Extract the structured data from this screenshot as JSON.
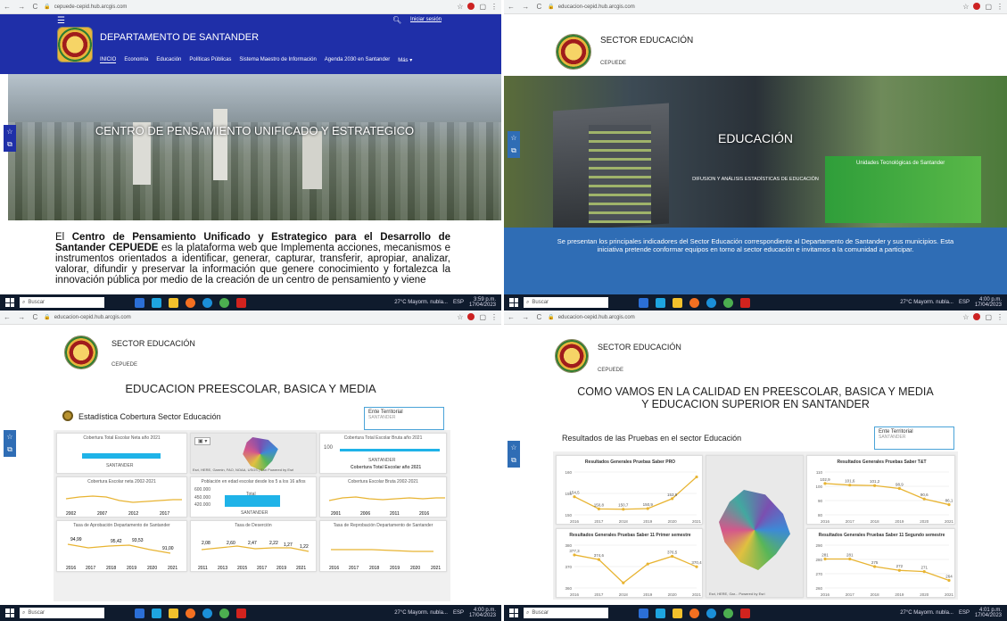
{
  "q1": {
    "url": "cepuede-cepid.hub.arcgis.com",
    "signin": "Iniciar sesión",
    "site_title": "DEPARTAMENTO DE SANTANDER",
    "nav": [
      "INICIO",
      "Economía",
      "Educación",
      "Políticas Públicas",
      "Sistema Maestro de Información",
      "Agenda 2030 en Santander",
      "Más ▾"
    ],
    "hero_title": "CENTRO DE PENSAMIENTO UNIFICADO Y ESTRATEGICO",
    "body_pre": "El ",
    "body_bold": "Centro de Pensamiento Unificado y Estrategico para el Desarrollo de Santander CEPUEDE",
    "body_rest": " es la plataforma web que Implementa acciones, mecanismos e instrumentos orientados a identificar, generar, capturar, transferir, apropiar, analizar, valorar, difundir y preservar la información que genere conocimiento y fortalezca la innovación pública por medio de la creación de un centro de pensamiento y viene",
    "taskbar": {
      "search": "Buscar",
      "weather": "27°C Mayorm. nubla...",
      "lang": "ESP",
      "time": "3:59 p.m.",
      "date": "17/04/2023"
    }
  },
  "q2": {
    "url": "educacion-cepid.hub.arcgis.com",
    "site_title": "SECTOR EDUCACIÓN",
    "subtitle": "CEPUEDE",
    "hero_title": "EDUCACIÓN",
    "hero_sub": "DIFUSION Y ANÁLISIS ESTADÍSTICAS DE EDUCACIÓN",
    "building_sign": "Unidades Tecnológicas de Santander",
    "banner": "Se presentan los principales indicadores del Sector Educación correspondiente al Departamento de Santander y sus municipios. Esta iniciativa pretende conformar equipos en torno al sector educación e invitamos a la comunidad a participar.",
    "taskbar": {
      "search": "Buscar",
      "weather": "27°C Mayorm. nubla...",
      "lang": "ESP",
      "time": "4:00 p.m.",
      "date": "17/04/2023"
    }
  },
  "q3": {
    "url": "educacion-cepid.hub.arcgis.com",
    "site_title": "SECTOR EDUCACIÓN",
    "subtitle": "CEPUEDE",
    "heading": "EDUCACION PREESCOLAR, BASICA Y MEDIA",
    "panel_title": "Estadística Cobertura Sector Educación",
    "ente_label": "Ente Territorial",
    "ente_value": "SANTANDER",
    "cards": {
      "c1": {
        "title": "Cobertura Total Escolar Neta año 2021",
        "ticks": [
          "80",
          "60",
          "40",
          "20",
          "0"
        ],
        "xlab": "SANTANDER"
      },
      "c2": {
        "title": "Cobertura Escolar neta 2002-2021",
        "xticks": [
          "2002",
          "2007",
          "2012",
          "2017"
        ]
      },
      "c3": {
        "title": "Tasa de Aprobación Departamento de Santander",
        "values": [
          "94,99",
          "95,42",
          "93,53",
          "91,00"
        ],
        "xticks": [
          "2016",
          "2017",
          "2018",
          "2019",
          "2020",
          "2021"
        ]
      },
      "c4": {
        "title": "Población en edad escolar desde los 5 a los 16 años",
        "ticks": [
          "600.000",
          "450.000",
          "420.000"
        ],
        "bar_label": "SANTANDER",
        "bar_value": "Total"
      },
      "c5": {
        "title": "Tasa de Deserción",
        "values": [
          "2,08",
          "2,60",
          "2,47",
          "2,22",
          "1,27",
          "1,22"
        ],
        "xticks": [
          "2011",
          "2013",
          "2015",
          "2017",
          "2019",
          "2021"
        ]
      },
      "c6": {
        "title": "Cobertura Total Escolar Bruta año 2021",
        "value": "100",
        "xlab": "SANTANDER",
        "sub": "Cobertura Total Escolar año 2021"
      },
      "c7": {
        "title": "Cobertura Escolar Bruta 2002-2021",
        "xticks": [
          "2001",
          "2006",
          "2011",
          "2016"
        ]
      },
      "c8": {
        "title": "Tasa de Reprobación Departamento de Santander",
        "xticks": [
          "2016",
          "2017",
          "2018",
          "2019",
          "2020",
          "2021"
        ]
      }
    },
    "map_credit": "Esri, HERE, Garmin, FAO, NOAA, USGS | Esri    Powered by Esri",
    "taskbar": {
      "search": "Buscar",
      "weather": "27°C Mayorm. nubla...",
      "lang": "ESP",
      "time": "4:00 p.m.",
      "date": "17/04/2023"
    }
  },
  "q4": {
    "url": "educacion-cepid.hub.arcgis.com",
    "site_title": "SECTOR EDUCACIÓN",
    "subtitle": "CEPUEDE",
    "heading1": "COMO VAMOS EN LA CALIDAD EN PREESCOLAR, BASICA Y MEDIA",
    "heading2": "Y EDUCACION SUPERIOR EN SANTANDER",
    "panel_title": "Resultados de las Pruebas en el sector Educación",
    "ente_label": "Ente Territorial",
    "ente_value": "SANTANDER",
    "map_credit": "Esri, HERE, Gar...    Powered by Esri",
    "taskbar": {
      "search": "Buscar",
      "weather": "27°C Mayorm. nubla...",
      "lang": "ESP",
      "time": "4:01 p.m.",
      "date": "17/04/2023"
    }
  },
  "chart_data": [
    {
      "type": "line",
      "title": "Resultados Generales Pruebas Saber PRO",
      "x": [
        "2016",
        "2017",
        "2018",
        "2019",
        "2020",
        "2021"
      ],
      "y_ticks": [
        "160",
        "155",
        "150"
      ],
      "ylim": [
        149,
        162
      ],
      "values": [
        154.5,
        150.8,
        150.7,
        150.9,
        153.9,
        160.5
      ],
      "labels": [
        "154,5",
        "150,8",
        "150,7",
        "150,9",
        "153,9",
        ""
      ]
    },
    {
      "type": "line",
      "title": "Resultados Generales Pruebas Saber T&T",
      "x": [
        "2016",
        "2017",
        "2018",
        "2019",
        "2020",
        "2021"
      ],
      "y_ticks": [
        "110",
        "100",
        "90",
        "80"
      ],
      "ylim": [
        78,
        112
      ],
      "values": [
        102.9,
        101.6,
        101.2,
        98.9,
        90.6,
        86.1
      ],
      "labels": [
        "102,9",
        "101,6",
        "101,2",
        "98,9",
        "90,6",
        "86,1"
      ]
    },
    {
      "type": "line",
      "title": "Resultados Generales Pruebas Saber 11 Primer semestre",
      "x": [
        "2016",
        "2017",
        "2018",
        "2019",
        "2020",
        "2021"
      ],
      "y_ticks": [
        "380",
        "370",
        "360"
      ],
      "ylim": [
        358,
        383
      ],
      "values": [
        377.3,
        374.6,
        361.0,
        372.0,
        376.5,
        370.4
      ],
      "labels": [
        "377,3",
        "374,6",
        "",
        "",
        "376,5",
        "370,4"
      ]
    },
    {
      "type": "line",
      "title": "Resultados Generales Pruebas Saber 11 Segundo semestre",
      "x": [
        "2016",
        "2017",
        "2018",
        "2019",
        "2020",
        "2021"
      ],
      "y_ticks": [
        "290",
        "280",
        "270",
        "260"
      ],
      "ylim": [
        258,
        292
      ],
      "values": [
        281,
        281,
        275,
        272,
        271,
        264
      ],
      "labels": [
        "281",
        "281",
        "275",
        "272",
        "271",
        "264"
      ]
    }
  ],
  "colors": {
    "navy": "#1f2fa8",
    "blue_banner": "#2f6db5",
    "accent_line": "#e8b432",
    "bar_blue": "#1fb3e8",
    "page_bg": "#f0f0f0"
  }
}
